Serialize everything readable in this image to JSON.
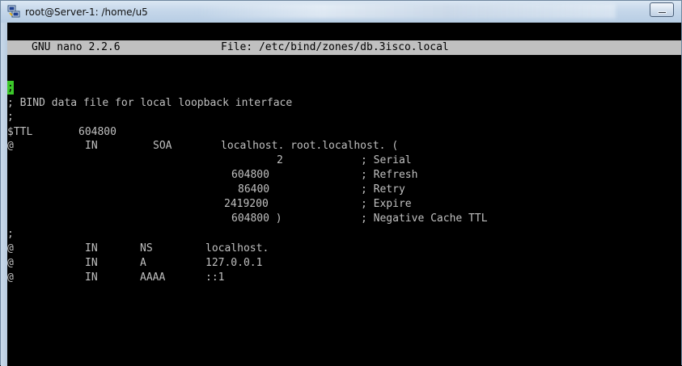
{
  "window": {
    "title": "root@Server-1: /home/u5"
  },
  "nano": {
    "version": "GNU nano 2.2.6",
    "file_label": "File: /etc/bind/zones/db.3isco.local"
  },
  "lines": {
    "l1": ";",
    "l2": "; BIND data file for local loopback interface",
    "l3": ";",
    "ttl": {
      "key": "$TTL",
      "val": "604800"
    },
    "soa": {
      "a": "@",
      "b": "IN",
      "c": "SOA",
      "d": "localhost. root.localhost. ("
    },
    "serial": {
      "num": "2",
      "comment": "; Serial"
    },
    "refresh": {
      "num": "604800",
      "comment": "; Refresh"
    },
    "retry": {
      "num": "86400",
      "comment": "; Retry"
    },
    "expire": {
      "num": "2419200",
      "comment": "; Expire"
    },
    "neg": {
      "num": "604800 )",
      "comment": "; Negative Cache TTL"
    },
    "l10": ";",
    "ns": {
      "a": "@",
      "b": "IN",
      "c": "NS",
      "d": "localhost."
    },
    "a": {
      "a": "@",
      "b": "IN",
      "c": "A",
      "d": "127.0.0.1"
    },
    "aaaa": {
      "a": "@",
      "b": "IN",
      "c": "AAAA",
      "d": "::1"
    }
  }
}
